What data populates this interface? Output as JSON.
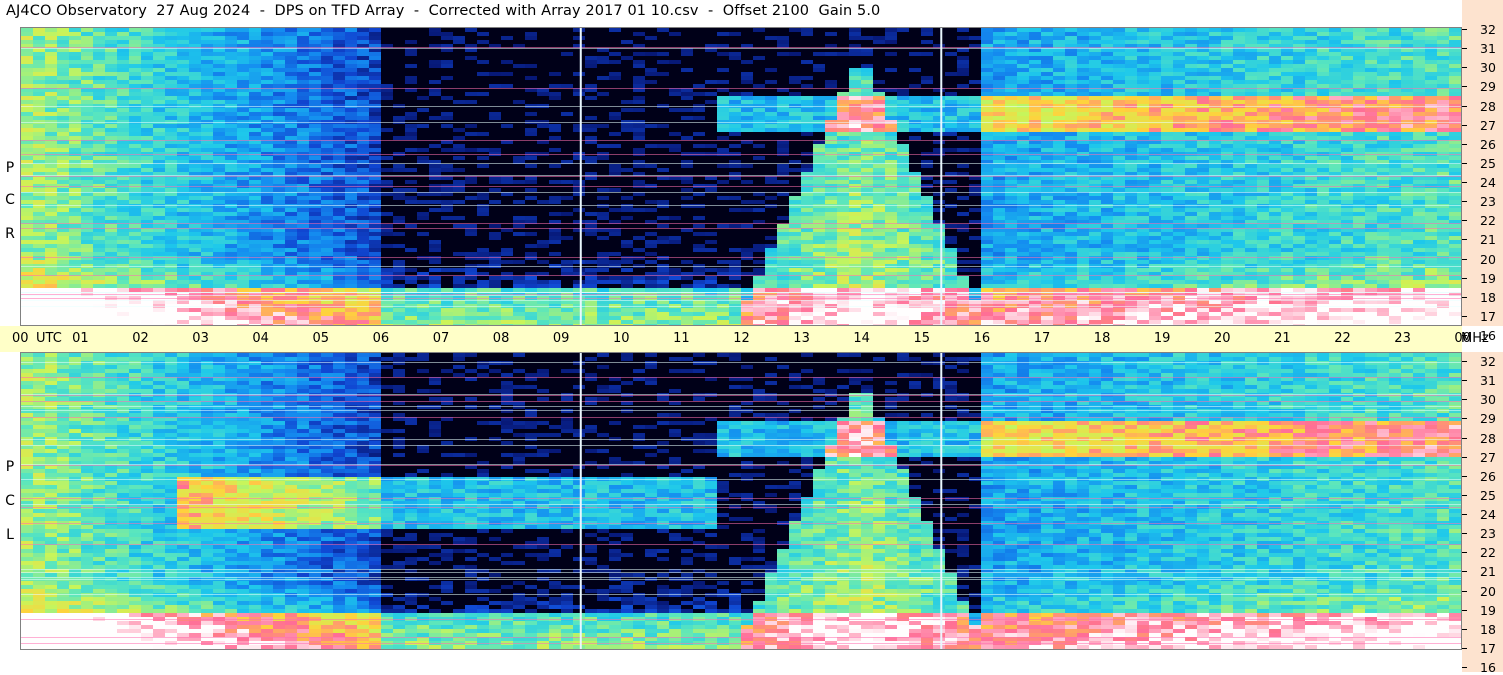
{
  "title": "AJ4CO Observatory  27 Aug 2024  -  DPS on TFD Array  -  Corrected with Array 2017 01 10.csv  -  Offset 2100  Gain 5.0",
  "top_panel": {
    "polarization_letters": [
      "P",
      "C",
      "R"
    ]
  },
  "bottom_panel": {
    "polarization_letters": [
      "P",
      "C",
      "L"
    ]
  },
  "colors": {
    "background": "#000018",
    "time_bar": "#ffffc8",
    "freq_bar": "#fde3cf"
  },
  "chart_data": {
    "type": "heatmap",
    "x_label": "UTC",
    "y_unit": "MHz",
    "x_ticks": [
      "00",
      "01",
      "02",
      "03",
      "04",
      "05",
      "06",
      "07",
      "08",
      "09",
      "10",
      "11",
      "12",
      "13",
      "14",
      "15",
      "16",
      "17",
      "18",
      "19",
      "20",
      "21",
      "22",
      "23",
      "00"
    ],
    "y_ticks": [
      32,
      31,
      30,
      29,
      28,
      27,
      26,
      25,
      24,
      23,
      22,
      21,
      20,
      19,
      18,
      17,
      16
    ],
    "x_range_hours": [
      0,
      24
    ],
    "y_range_mhz": [
      16,
      32
    ],
    "vertical_markers_utc_hours": [
      9.3,
      15.3
    ],
    "panels": [
      "RCP",
      "LCP"
    ]
  }
}
